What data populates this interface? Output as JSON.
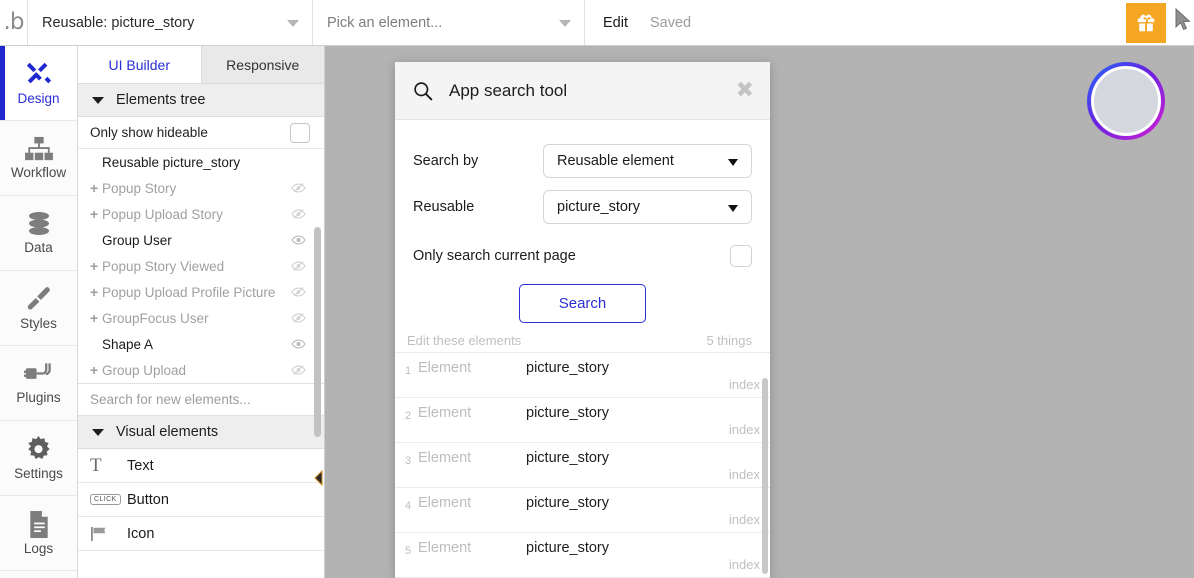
{
  "topbar": {
    "logo": "logo-b",
    "page_selector": {
      "value": "Reusable: picture_story",
      "icon": "chevron-down-icon"
    },
    "element_picker": {
      "placeholder": "Pick an element...",
      "icon": "chevron-down-icon"
    },
    "edit_label": "Edit",
    "saved_label": "Saved",
    "gift_icon": "gift-icon",
    "cursor_icon": "cursor-arrow-icon"
  },
  "rail": {
    "items": [
      {
        "label": "Design",
        "icon": "design-icon",
        "active": true
      },
      {
        "label": "Workflow",
        "icon": "workflow-icon",
        "active": false
      },
      {
        "label": "Data",
        "icon": "database-icon",
        "active": false
      },
      {
        "label": "Styles",
        "icon": "brush-icon",
        "active": false
      },
      {
        "label": "Plugins",
        "icon": "plug-icon",
        "active": false
      },
      {
        "label": "Settings",
        "icon": "gear-icon",
        "active": false
      },
      {
        "label": "Logs",
        "icon": "document-icon",
        "active": false
      }
    ]
  },
  "panel": {
    "tabs": [
      {
        "label": "UI Builder",
        "active": true
      },
      {
        "label": "Responsive",
        "active": false
      }
    ],
    "elements_tree_title": "Elements tree",
    "only_show_hideable_label": "Only show hideable",
    "only_show_hideable_checked": false,
    "tree": [
      {
        "label": "Reusable picture_story",
        "expandable": false,
        "hidden": false,
        "eye": "none"
      },
      {
        "label": "Popup Story",
        "expandable": true,
        "hidden": true,
        "eye": "eye-slash-icon"
      },
      {
        "label": "Popup Upload Story",
        "expandable": true,
        "hidden": true,
        "eye": "eye-slash-icon"
      },
      {
        "label": "Group User",
        "expandable": false,
        "hidden": false,
        "eye": "eye-icon"
      },
      {
        "label": "Popup Story Viewed",
        "expandable": true,
        "hidden": true,
        "eye": "eye-slash-icon"
      },
      {
        "label": "Popup Upload Profile Picture",
        "expandable": true,
        "hidden": true,
        "eye": "eye-slash-icon"
      },
      {
        "label": "GroupFocus User",
        "expandable": true,
        "hidden": true,
        "eye": "eye-slash-icon"
      },
      {
        "label": "Shape A",
        "expandable": false,
        "hidden": false,
        "eye": "eye-icon"
      },
      {
        "label": "Group Upload",
        "expandable": true,
        "hidden": true,
        "eye": "eye-slash-icon"
      }
    ],
    "search_new_placeholder": "Search for new elements...",
    "visual_elements_title": "Visual elements",
    "visual_elements": [
      {
        "label": "Text",
        "icon": "text-T-icon"
      },
      {
        "label": "Button",
        "icon": "click-button-icon"
      },
      {
        "label": "Icon",
        "icon": "flag-icon"
      }
    ],
    "collapse_icon": "collapse-left-arrow-icon"
  },
  "canvas": {
    "avatar": {
      "icon": "avatar-circle",
      "ring_gradient": [
        "#1f6bff",
        "#6a22e0",
        "#d41fd4"
      ],
      "fill": "#d4d7de"
    },
    "background": "#b3b3b3"
  },
  "modal": {
    "title": "App search tool",
    "search_icon": "search-icon",
    "close_icon": "close-icon",
    "fields": [
      {
        "label": "Search by",
        "value": "Reusable element",
        "icon": "chevron-down-icon"
      },
      {
        "label": "Reusable",
        "value": "picture_story",
        "icon": "chevron-down-icon"
      }
    ],
    "only_current_page_label": "Only search current page",
    "only_current_page_checked": false,
    "search_button": "Search",
    "results_header": {
      "left": "Edit these elements",
      "right": "5 things"
    },
    "results": [
      {
        "index": "1",
        "type": "Element",
        "name": "picture_story",
        "page": "index"
      },
      {
        "index": "2",
        "type": "Element",
        "name": "picture_story",
        "page": "index"
      },
      {
        "index": "3",
        "type": "Element",
        "name": "picture_story",
        "page": "index"
      },
      {
        "index": "4",
        "type": "Element",
        "name": "picture_story",
        "page": "index"
      },
      {
        "index": "5",
        "type": "Element",
        "name": "picture_story",
        "page": "index"
      }
    ]
  },
  "colors": {
    "accent_blue": "#2a2fd6",
    "gift_orange": "#f5a623",
    "canvas_gray": "#b3b3b3"
  }
}
